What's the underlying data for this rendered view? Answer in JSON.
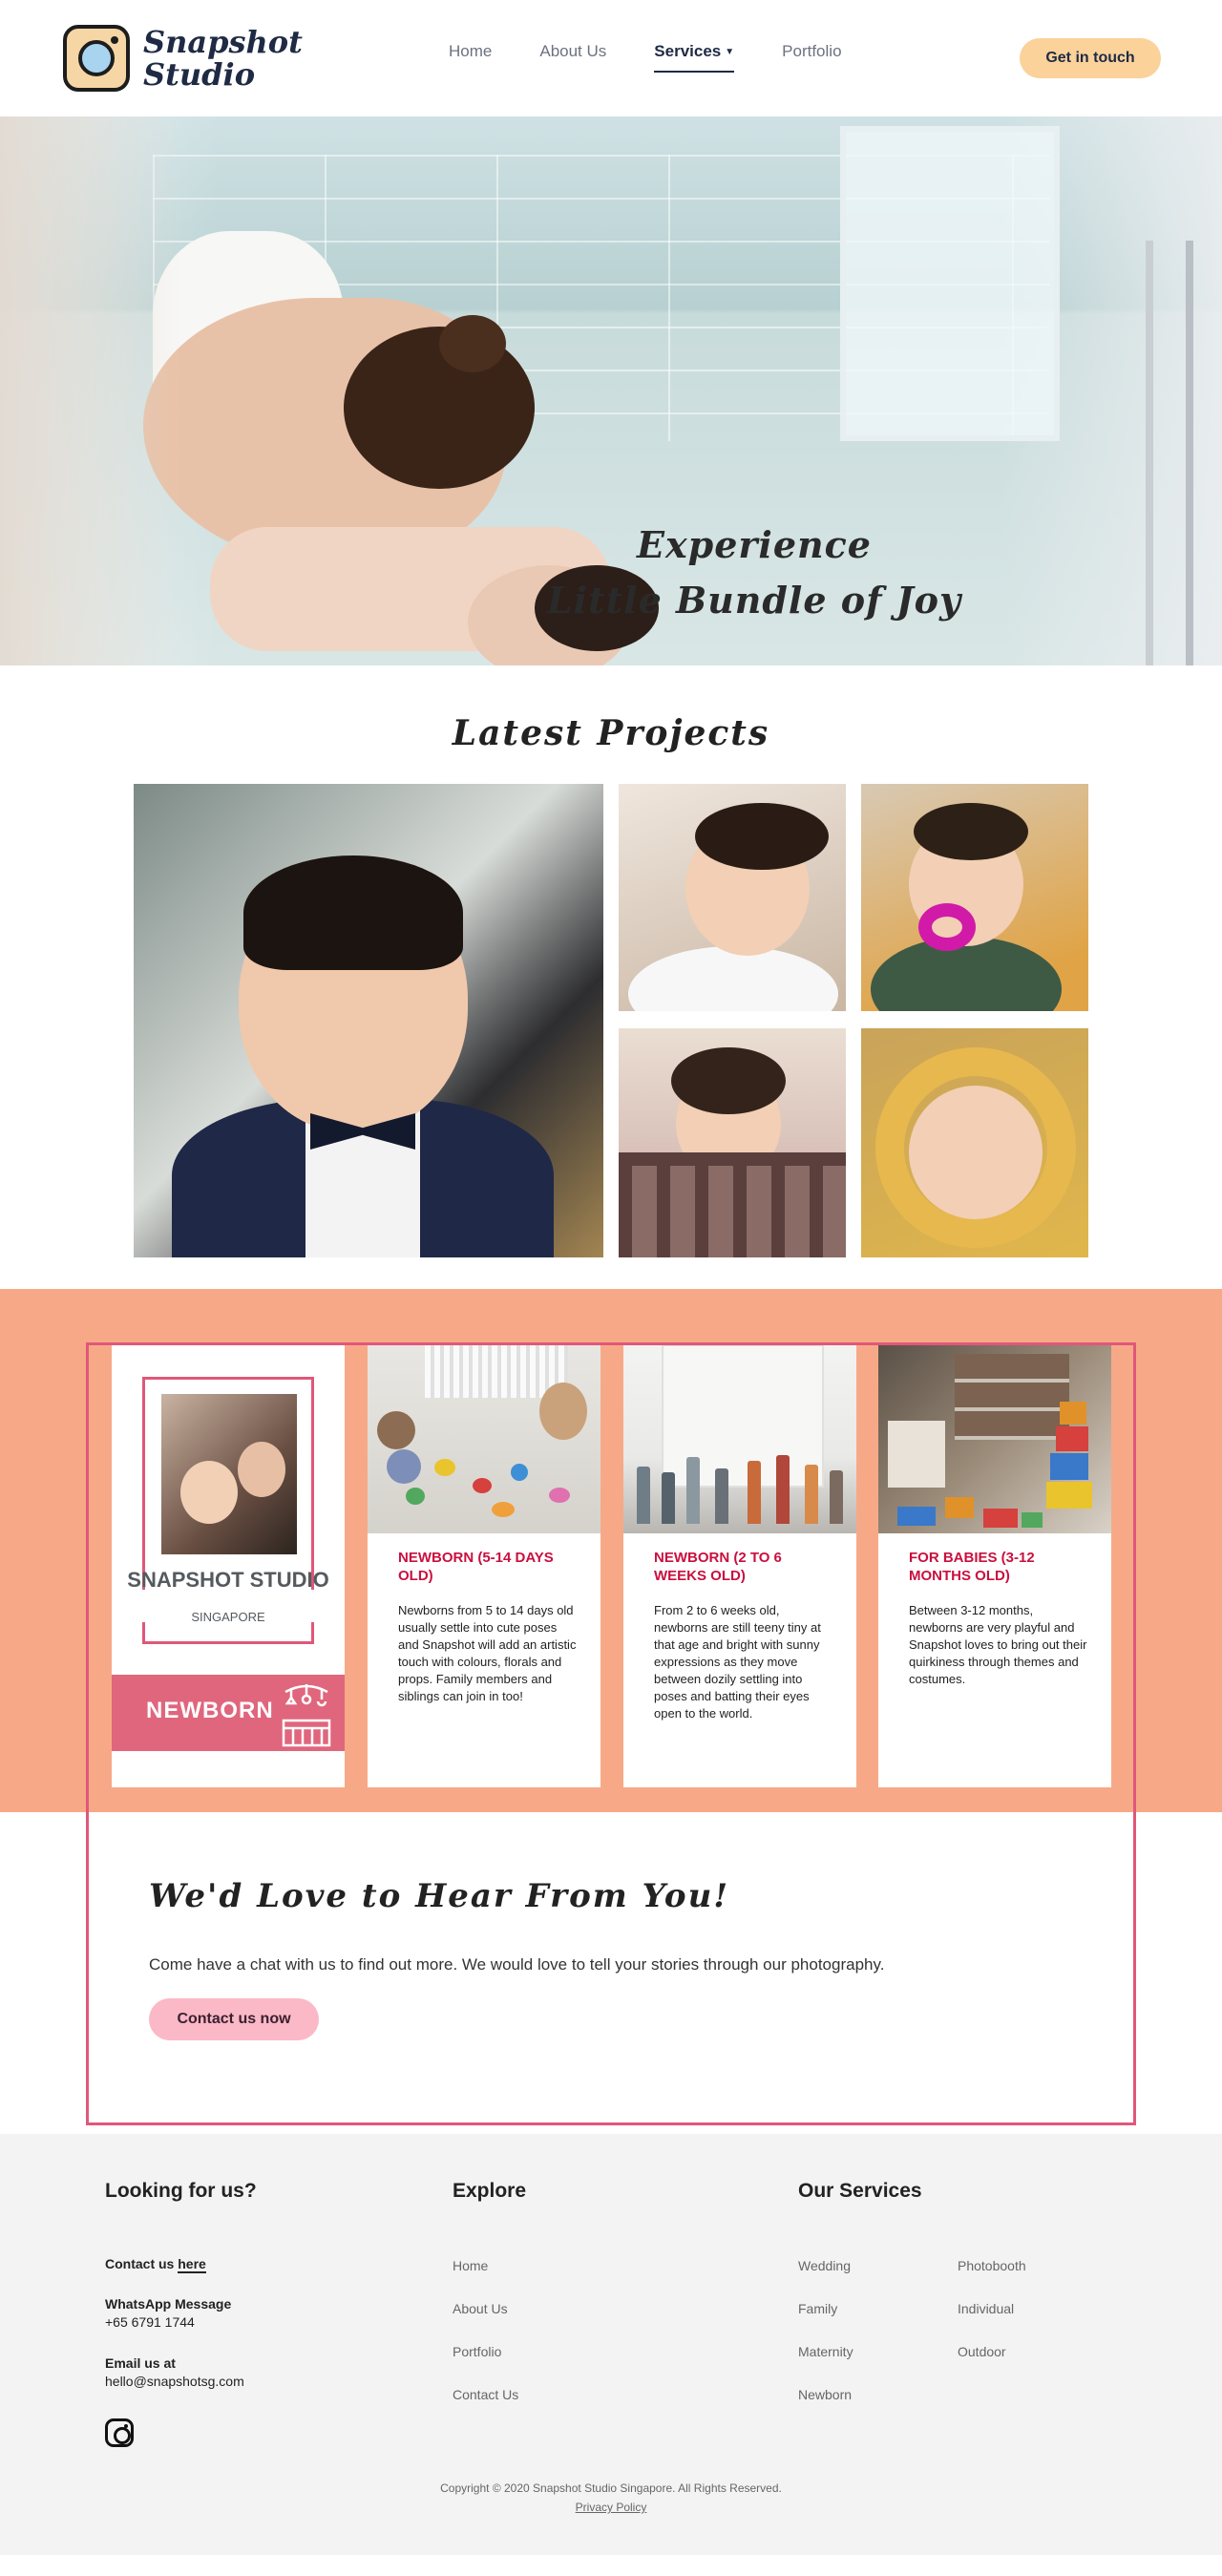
{
  "brand": {
    "logo_line1": "Snapshot",
    "logo_line2": "Studio"
  },
  "nav": {
    "items": [
      {
        "label": "Home"
      },
      {
        "label": "About Us"
      },
      {
        "label": "Services"
      },
      {
        "label": "Portfolio"
      }
    ],
    "active": "Services",
    "cta_label": "Get in touch"
  },
  "hero": {
    "line1": "Experience",
    "line2": "Little Bundle of Joy"
  },
  "projects": {
    "title": "Latest Projects"
  },
  "services": {
    "brand_card": {
      "name": "SNAPSHOT STUDIO",
      "location": "SINGAPORE",
      "category": "NEWBORN"
    },
    "cards": [
      {
        "title": "NEWBORN (5-14 DAYS OLD)",
        "description": "Newborns from 5 to 14 days old usually settle into cute poses and Snapshot will add an artistic touch with colours, florals and props. Family members and siblings can join in too!"
      },
      {
        "title": "NEWBORN (2 TO 6 WEEKS OLD)",
        "description": "From 2 to 6 weeks old, newborns are still teeny tiny at that age and bright with sunny expressions as they move between dozily settling into poses and batting their eyes open to the world."
      },
      {
        "title": "FOR BABIES (3-12 MONTHS OLD)",
        "description": "Between 3-12 months, newborns are very playful and Snapshot loves to bring out their quirkiness through themes and costumes."
      }
    ]
  },
  "contact": {
    "title": "We'd Love to Hear From You!",
    "text": "Come have a chat with us to find out more. We would love to tell your stories through our photography.",
    "button_label": "Contact us now"
  },
  "footer": {
    "col1": {
      "title": "Looking for us?",
      "contact_prefix": "Contact us",
      "contact_link": "here",
      "whatsapp_label": "WhatsApp Message",
      "whatsapp_number": "+65 6791 1744",
      "email_label": "Email us at",
      "email": "hello@snapshotsg.com"
    },
    "col2": {
      "title": "Explore",
      "links": [
        "Home",
        "About Us",
        "Portfolio",
        "Contact Us"
      ]
    },
    "col3": {
      "title": "Our Services",
      "links_left": [
        "Wedding",
        "Family",
        "Maternity",
        "Newborn"
      ],
      "links_right": [
        "Photobooth",
        "Individual",
        "Outdoor"
      ]
    },
    "copyright": "Copyright © 2020 Snapshot Studio Singapore. All Rights Reserved.",
    "privacy": "Privacy Policy"
  },
  "colors": {
    "accent_peach": "#f7a987",
    "accent_pink": "#e0577a",
    "cta_yellow": "#fad29a",
    "title_red": "#c9103f"
  },
  "icons": [
    "camera-logo-icon",
    "caret-down-icon",
    "baby-mobile-icon",
    "instagram-icon"
  ]
}
